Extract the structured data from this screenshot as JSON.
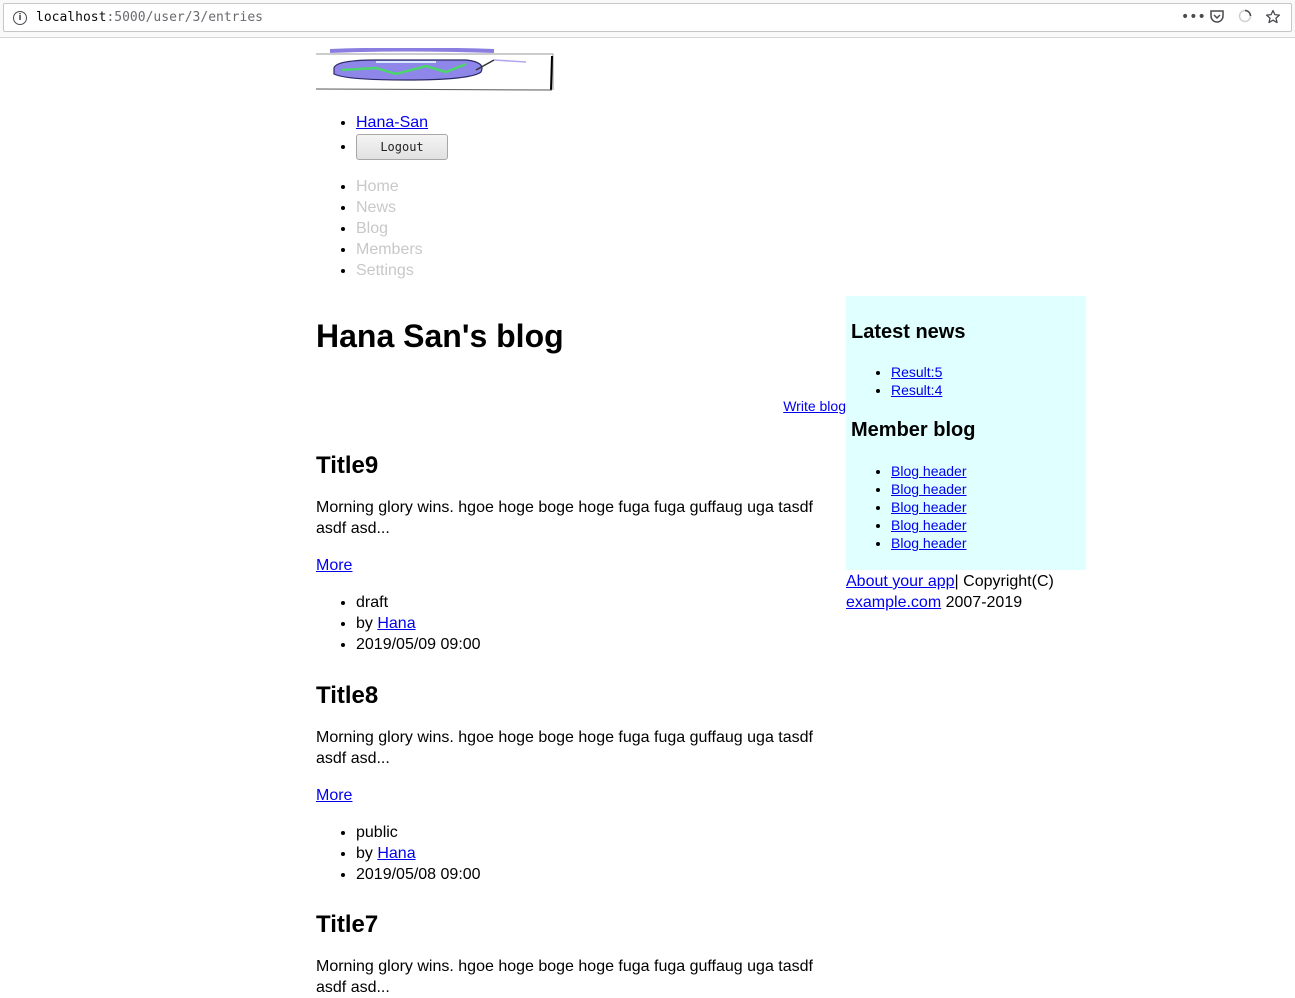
{
  "browser": {
    "url_host": "localhost",
    "url_path": ":5000/user/3/entries"
  },
  "user_menu": {
    "username": "Hana-San",
    "logout_label": "Logout"
  },
  "nav": {
    "items": [
      "Home",
      "News",
      "Blog",
      "Members",
      "Settings"
    ]
  },
  "blog": {
    "title": "Hana San's blog",
    "write_link": "Write blog"
  },
  "entries": [
    {
      "title": "Title9",
      "summary": "Morning glory wins. hgoe hoge boge hoge fuga fuga guffaug uga tasdf asdf asd...",
      "more": "More",
      "status": "draft",
      "by_prefix": "by ",
      "author": "Hana",
      "date": "2019/05/09 09:00"
    },
    {
      "title": "Title8",
      "summary": "Morning glory wins. hgoe hoge boge hoge fuga fuga guffaug uga tasdf asdf asd...",
      "more": "More",
      "status": "public",
      "by_prefix": "by ",
      "author": "Hana",
      "date": "2019/05/08 09:00"
    },
    {
      "title": "Title7",
      "summary": "Morning glory wins. hgoe hoge boge hoge fuga fuga guffaug uga tasdf asdf asd..."
    }
  ],
  "sidebar": {
    "latest_news_heading": "Latest news",
    "news": [
      "Result:5",
      "Result:4"
    ],
    "member_blog_heading": "Member blog",
    "member_blogs": [
      "Blog header",
      "Blog header",
      "Blog header",
      "Blog header",
      "Blog header"
    ],
    "background_color": "#e0ffff"
  },
  "footer": {
    "about_link": "About your app",
    "copyright_text": "| Copyright(C)",
    "site_link": "example.com",
    "years": " 2007-2019"
  }
}
